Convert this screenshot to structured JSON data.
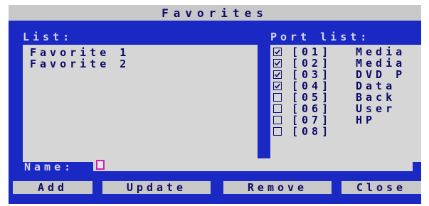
{
  "window": {
    "title": "Favorites"
  },
  "favorites": {
    "label": "List:",
    "items": [
      "Favorite 1",
      "Favorite 2"
    ]
  },
  "ports": {
    "label": "Port list:",
    "items": [
      {
        "code": "[01]",
        "name": "Media",
        "checked": true
      },
      {
        "code": "[02]",
        "name": "Media",
        "checked": true
      },
      {
        "code": "[03]",
        "name": "DVD P",
        "checked": true
      },
      {
        "code": "[04]",
        "name": "Data",
        "checked": true
      },
      {
        "code": "[05]",
        "name": "Back",
        "checked": false
      },
      {
        "code": "[06]",
        "name": "User",
        "checked": false
      },
      {
        "code": "[07]",
        "name": "HP",
        "checked": false
      },
      {
        "code": "[08]",
        "name": "",
        "checked": false
      }
    ]
  },
  "name_field": {
    "label": "Name:",
    "value": ""
  },
  "buttons": {
    "add": "Add",
    "update": "Update",
    "remove": "Remove",
    "close": "Close"
  },
  "colors": {
    "panel": "#1a28c4",
    "field": "#d6d6d6",
    "text": "#0b0b6a",
    "label": "#d8d8e8",
    "cursor": "#d020b0"
  }
}
